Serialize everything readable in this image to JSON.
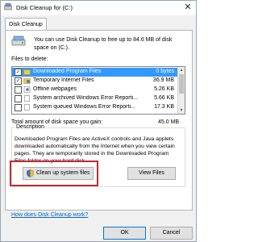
{
  "window": {
    "title": "Disk Cleanup for  (C:)"
  },
  "tabs": [
    {
      "label": "Disk Cleanup"
    }
  ],
  "intro_text": "You can use Disk Cleanup to free up to 84.6 MB of disk space on  (C:).",
  "files_label": "Files to delete:",
  "files": [
    {
      "name": "Downloaded Program Files",
      "size": "0 bytes",
      "checked": true,
      "selected": true
    },
    {
      "name": "Temporary Internet Files",
      "size": "36.9 MB",
      "checked": true,
      "selected": false
    },
    {
      "name": "Offline webpages",
      "size": "5.26 KB",
      "checked": false,
      "selected": false
    },
    {
      "name": "System archived Windows Error Reporti...",
      "size": "5.66 KB",
      "checked": false,
      "selected": false
    },
    {
      "name": "System queued Windows Error Reporti...",
      "size": "17.3 KB",
      "checked": false,
      "selected": false
    }
  ],
  "total_label": "Total amount of disk space you gain:",
  "total_value": "45.0 MB",
  "description": {
    "legend": "Description",
    "text": "Downloaded Program Files are ActiveX controls and Java applets downloaded automatically from the Internet when you view certain pages. They are temporarily stored in the Downloaded Program Files folder on your hard disk."
  },
  "buttons": {
    "cleanup_system": "Clean up system files",
    "view_files": "View Files",
    "ok": "OK",
    "cancel": "Cancel"
  },
  "help_link": "How does Disk Cleanup work?",
  "colors": {
    "selection": "#3399ff",
    "highlight_box": "#c8282e",
    "link": "#0066cc"
  },
  "icons": {
    "title": "disk-cleanup-icon",
    "drive": "drive-icon",
    "shield": "uac-shield-icon",
    "close": "close-icon"
  }
}
